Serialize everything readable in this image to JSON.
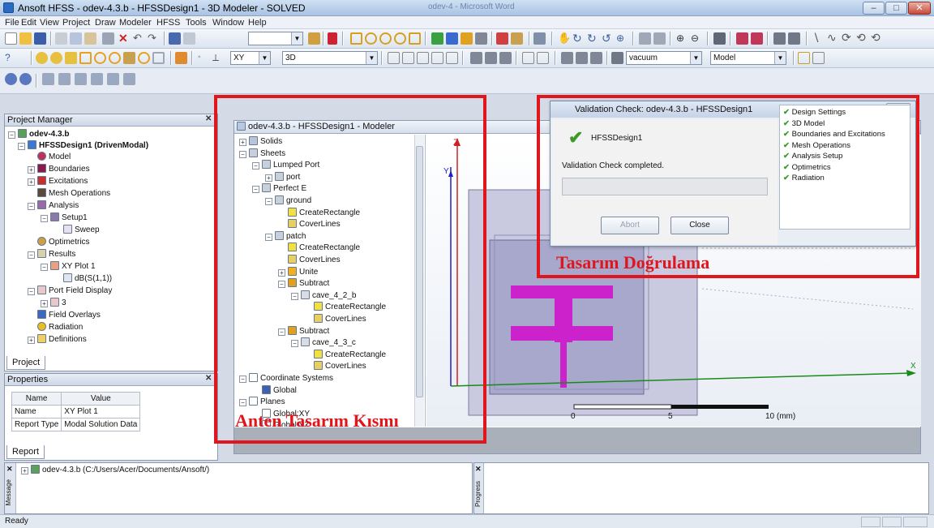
{
  "window": {
    "title": "Ansoft HFSS - odev-4.3.b - HFSSDesign1 - 3D Modeler - SOLVED",
    "title_faded": "odev-4 - Microsoft Word",
    "min": "–",
    "max": "□",
    "close": "✕"
  },
  "menu": [
    "File",
    "Edit",
    "View",
    "Project",
    "Draw",
    "Modeler",
    "HFSS",
    "Tools",
    "Window",
    "Help"
  ],
  "toolbar": {
    "plane": "XY",
    "view": "3D",
    "material": "vacuum",
    "mode": "Model"
  },
  "project_manager": {
    "title": "Project Manager",
    "items": [
      {
        "label": "odev-4.3.b",
        "depth": 0,
        "exp": "−",
        "bold": true,
        "icon": "project-icon"
      },
      {
        "label": "HFSSDesign1 (DrivenModal)",
        "depth": 1,
        "exp": "−",
        "bold": true,
        "icon": "design-icon"
      },
      {
        "label": "Model",
        "depth": 2,
        "exp": "",
        "icon": "model-icon"
      },
      {
        "label": "Boundaries",
        "depth": 2,
        "exp": "+",
        "icon": "boundaries-icon"
      },
      {
        "label": "Excitations",
        "depth": 2,
        "exp": "+",
        "icon": "excitations-icon"
      },
      {
        "label": "Mesh Operations",
        "depth": 2,
        "exp": "",
        "icon": "mesh-icon"
      },
      {
        "label": "Analysis",
        "depth": 2,
        "exp": "−",
        "icon": "analysis-icon"
      },
      {
        "label": "Setup1",
        "depth": 3,
        "exp": "−",
        "icon": "setup-icon"
      },
      {
        "label": "Sweep",
        "depth": 4,
        "exp": "",
        "icon": "sweep-icon"
      },
      {
        "label": "Optimetrics",
        "depth": 2,
        "exp": "",
        "icon": "optimetrics-icon"
      },
      {
        "label": "Results",
        "depth": 2,
        "exp": "−",
        "icon": "results-icon"
      },
      {
        "label": "XY Plot 1",
        "depth": 3,
        "exp": "−",
        "icon": "plot-icon"
      },
      {
        "label": "dB(S(1,1))",
        "depth": 4,
        "exp": "",
        "icon": "trace-icon"
      },
      {
        "label": "Port Field Display",
        "depth": 2,
        "exp": "−",
        "icon": "port-field-icon"
      },
      {
        "label": "3",
        "depth": 3,
        "exp": "+",
        "icon": "port-icon"
      },
      {
        "label": "Field Overlays",
        "depth": 2,
        "exp": "",
        "icon": "field-overlay-icon"
      },
      {
        "label": "Radiation",
        "depth": 2,
        "exp": "",
        "icon": "radiation-icon"
      },
      {
        "label": "Definitions",
        "depth": 1,
        "exp": "+",
        "icon": "folder-icon"
      }
    ],
    "tab": "Project"
  },
  "properties": {
    "title": "Properties",
    "columns": [
      "Name",
      "Value"
    ],
    "rows": [
      [
        "Name",
        "XY Plot 1"
      ],
      [
        "Report Type",
        "Modal Solution Data"
      ]
    ],
    "tab": "Report"
  },
  "modeler": {
    "title": "odev-4.3.b - HFSSDesign1 - Modeler",
    "tree": [
      {
        "label": "Solids",
        "depth": 0,
        "exp": "+",
        "icon": "solids-icon"
      },
      {
        "label": "Sheets",
        "depth": 0,
        "exp": "−",
        "icon": "sheets-icon"
      },
      {
        "label": "Lumped Port",
        "depth": 1,
        "exp": "−",
        "icon": "sheets-icon"
      },
      {
        "label": "port",
        "depth": 2,
        "exp": "+",
        "icon": "sheets-icon"
      },
      {
        "label": "Perfect E",
        "depth": 1,
        "exp": "−",
        "icon": "sheets-icon"
      },
      {
        "label": "ground",
        "depth": 2,
        "exp": "−",
        "icon": "sheets-icon"
      },
      {
        "label": "CreateRectangle",
        "depth": 3,
        "exp": "",
        "icon": "rectangle-icon"
      },
      {
        "label": "CoverLines",
        "depth": 3,
        "exp": "",
        "icon": "coverlines-icon"
      },
      {
        "label": "patch",
        "depth": 2,
        "exp": "−",
        "icon": "sheets-icon"
      },
      {
        "label": "CreateRectangle",
        "depth": 3,
        "exp": "",
        "icon": "rectangle-icon"
      },
      {
        "label": "CoverLines",
        "depth": 3,
        "exp": "",
        "icon": "coverlines-icon"
      },
      {
        "label": "Unite",
        "depth": 3,
        "exp": "+",
        "icon": "unite-icon"
      },
      {
        "label": "Subtract",
        "depth": 3,
        "exp": "−",
        "icon": "subtract-icon"
      },
      {
        "label": "cave_4_2_b",
        "depth": 4,
        "exp": "−",
        "icon": "object-icon"
      },
      {
        "label": "CreateRectangle",
        "depth": 5,
        "exp": "",
        "icon": "rectangle-icon"
      },
      {
        "label": "CoverLines",
        "depth": 5,
        "exp": "",
        "icon": "coverlines-icon"
      },
      {
        "label": "Subtract",
        "depth": 3,
        "exp": "−",
        "icon": "subtract-icon"
      },
      {
        "label": "cave_4_3_c",
        "depth": 4,
        "exp": "−",
        "icon": "object-icon"
      },
      {
        "label": "CreateRectangle",
        "depth": 5,
        "exp": "",
        "icon": "rectangle-icon"
      },
      {
        "label": "CoverLines",
        "depth": 5,
        "exp": "",
        "icon": "coverlines-icon"
      },
      {
        "label": "Coordinate Systems",
        "depth": 0,
        "exp": "−",
        "icon": "coordinate-icon"
      },
      {
        "label": "Global",
        "depth": 1,
        "exp": "",
        "icon": "global-icon"
      },
      {
        "label": "Planes",
        "depth": 0,
        "exp": "−",
        "icon": "planes-icon"
      },
      {
        "label": "Global:XY",
        "depth": 1,
        "exp": "",
        "icon": "plane-icon"
      },
      {
        "label": "Global:YZ",
        "depth": 1,
        "exp": "",
        "icon": "plane-icon"
      }
    ],
    "axis_z": "Z",
    "axis_y": "Y",
    "axis_x": "X",
    "scale": {
      "min": "0",
      "mid": "5",
      "max": "10 (mm)"
    }
  },
  "validation": {
    "title": "Validation Check: odev-4.3.b - HFSSDesign1",
    "design": "HFSSDesign1",
    "status": "Validation Check completed.",
    "abort": "Abort",
    "close": "Close",
    "checks": [
      "Design Settings",
      "3D Model",
      "Boundaries and Excitations",
      "Mesh Operations",
      "Analysis Setup",
      "Optimetrics",
      "Radiation"
    ]
  },
  "annotations": {
    "left": "Anten Tasarım Kısmı",
    "right": "Tasarım Doğrulama"
  },
  "message": {
    "item": "odev-4.3.b (C:/Users/Acer/Documents/Ansoft/)",
    "tab": "Message",
    "progress_tab": "Progress"
  },
  "status": "Ready"
}
